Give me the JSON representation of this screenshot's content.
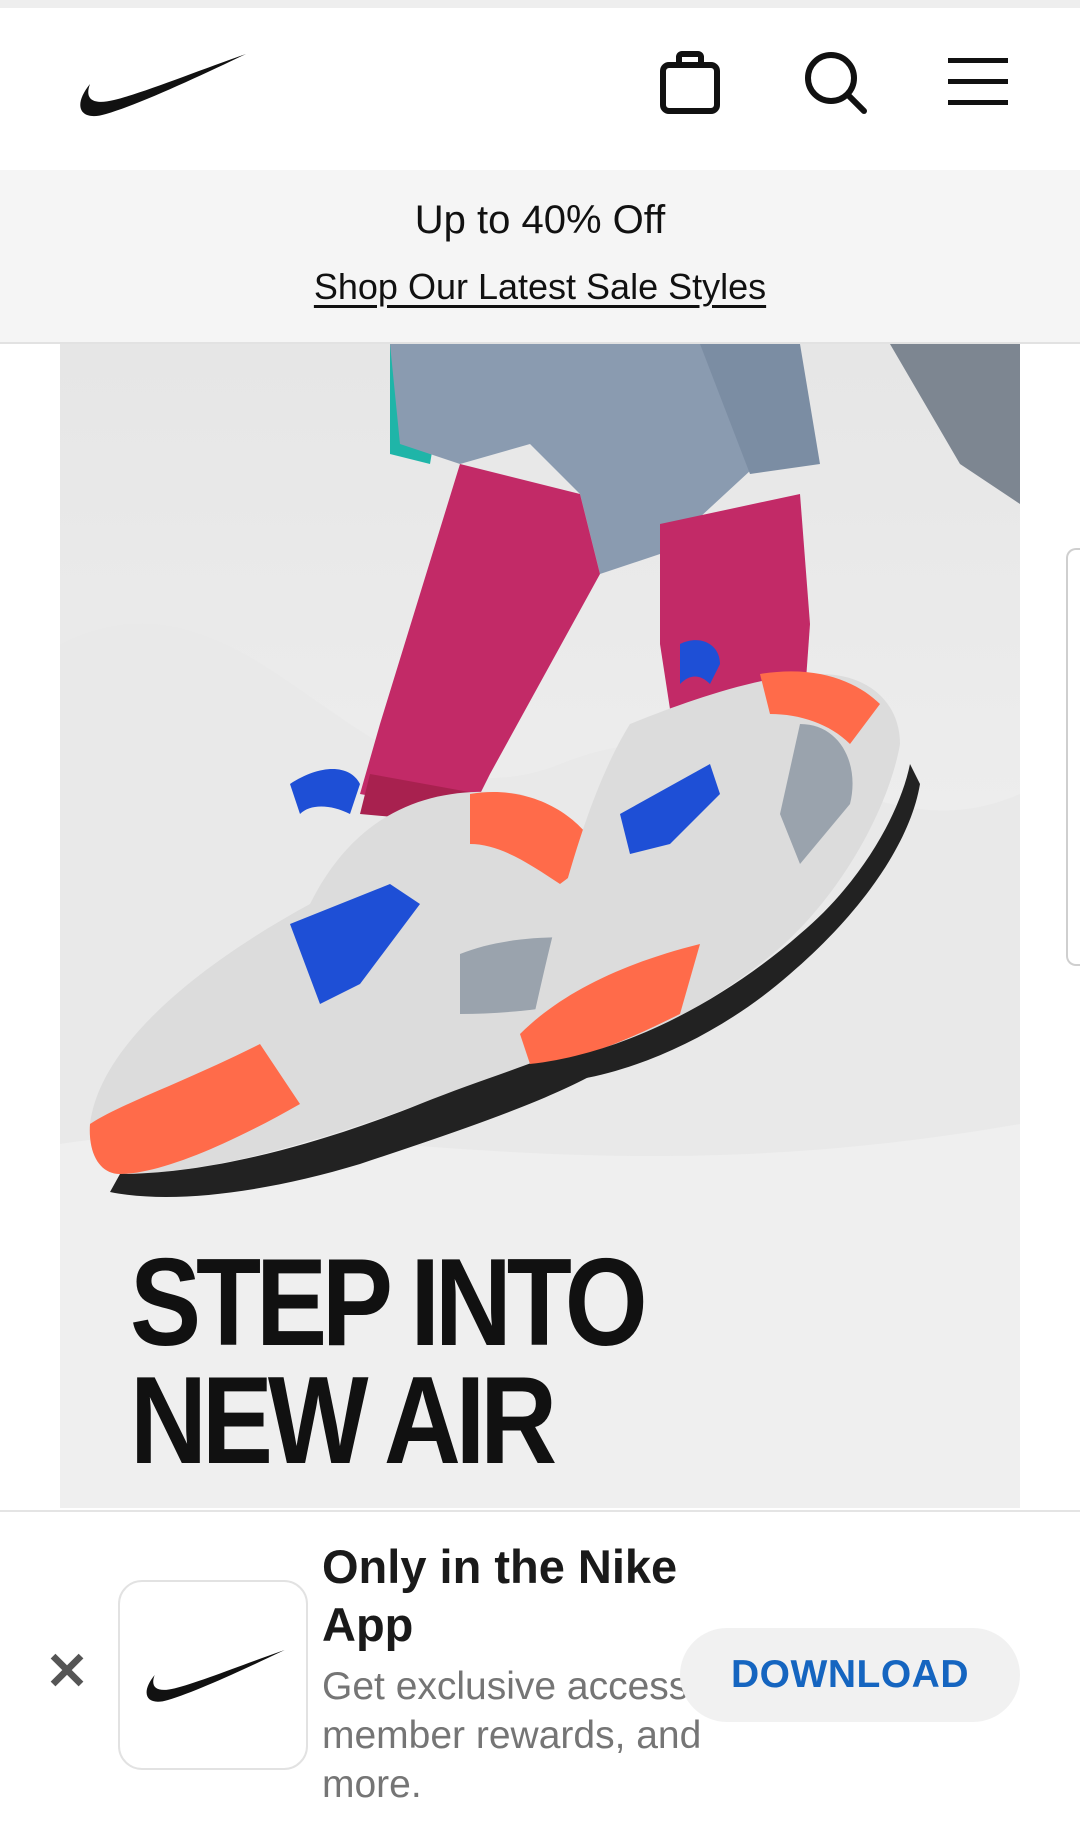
{
  "header": {
    "logo_icon": "nike-swoosh-icon",
    "bag_icon": "shopping-bag-icon",
    "search_icon": "search-icon",
    "menu_icon": "menu-icon"
  },
  "promo": {
    "title": "Up to 40% Off",
    "link": "Shop Our Latest Sale Styles"
  },
  "hero": {
    "headline_line1": "STEP INTO",
    "headline_line2": "NEW AIR"
  },
  "app_banner": {
    "close_label": "✕",
    "app_icon": "nike-swoosh-icon",
    "title": "Only in the Nike App",
    "description": "Get exclusive access, member rewards, and more.",
    "download_label": "DOWNLOAD"
  },
  "colors": {
    "accent_blue": "#1565c0",
    "sock_pink": "#b5285e",
    "shoe_orange": "#ff6b4a",
    "swoosh_blue": "#1e4fd6"
  }
}
